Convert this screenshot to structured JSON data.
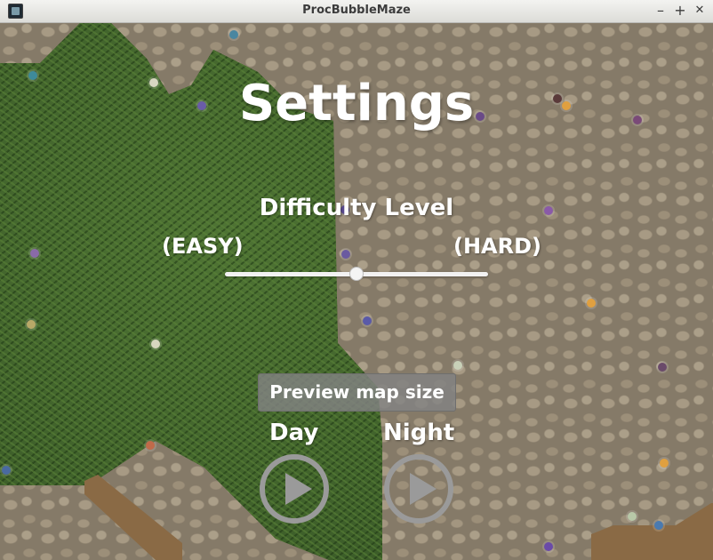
{
  "window": {
    "title": "ProcBubbleMaze",
    "minimize_glyph": "–",
    "maximize_glyph": "+",
    "close_glyph": "✕",
    "icon": "app-icon"
  },
  "settings": {
    "title": "Settings",
    "difficulty": {
      "label": "Difficulty Level",
      "min_label": "(EASY)",
      "max_label": "(HARD)",
      "value": 0.5
    },
    "preview_button_label": "Preview map size",
    "modes": [
      {
        "label": "Day",
        "icon": "play-icon"
      },
      {
        "label": "Night",
        "icon": "play-icon"
      }
    ]
  },
  "colors": {
    "text": "#ffffff",
    "button_bg": "#828282",
    "slider_track": "#f2f2f2",
    "play_icon": "#9a9a9a"
  }
}
